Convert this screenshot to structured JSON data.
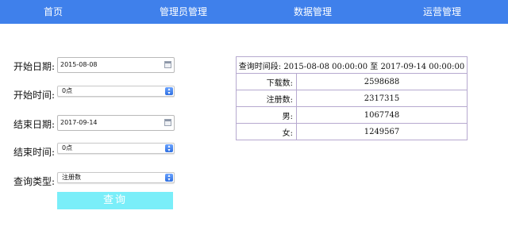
{
  "nav": {
    "items": [
      {
        "label": "首页"
      },
      {
        "label": "管理员管理"
      },
      {
        "label": "数据管理"
      },
      {
        "label": "运营管理"
      }
    ]
  },
  "form": {
    "start_date_label": "开始日期:",
    "start_date_value": "2015-08-08",
    "start_time_label": "开始时间:",
    "start_time_value": "0点",
    "end_date_label": "结束日期:",
    "end_date_value": "2017-09-14",
    "end_time_label": "结束时间:",
    "end_time_value": "0点",
    "query_type_label": "查询类型:",
    "query_type_value": "注册数",
    "query_button": "查询"
  },
  "results": {
    "header": "查询时间段: 2015-08-08 00:00:00 至 2017-09-14 00:00:00",
    "rows": [
      {
        "label": "下载数:",
        "value": "2598688"
      },
      {
        "label": "注册数:",
        "value": "2317315"
      },
      {
        "label": "男:",
        "value": "1067748"
      },
      {
        "label": "女:",
        "value": "1249567"
      }
    ]
  },
  "colors": {
    "nav_bg": "#3f80eb",
    "button_bg": "#7aeef9",
    "table_border": "#b6a9cf"
  },
  "icons": [
    "calendar-icon",
    "select-arrow-icon"
  ]
}
